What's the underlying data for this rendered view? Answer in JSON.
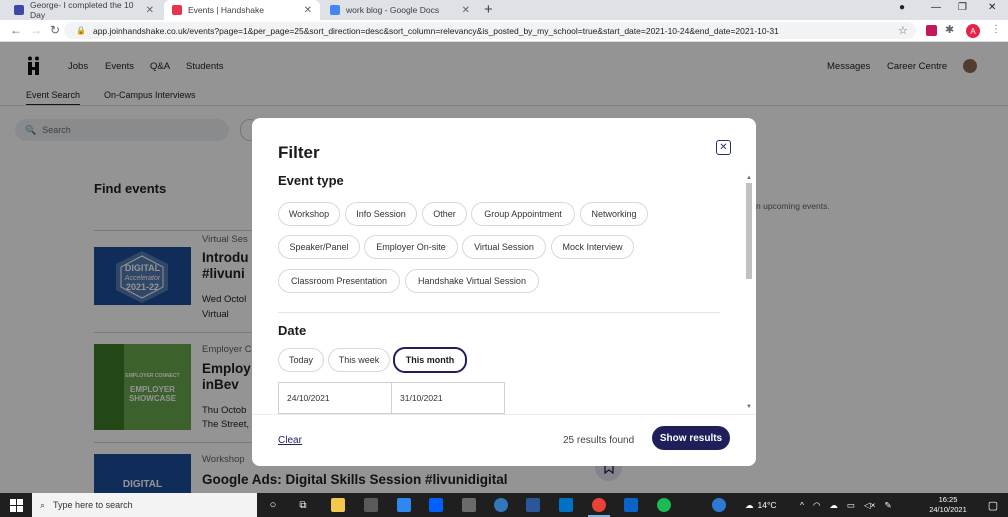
{
  "browser": {
    "tabs": [
      {
        "title": "George- I completed the 10 Day",
        "active": false
      },
      {
        "title": "Events | Handshake",
        "active": true
      },
      {
        "title": "work blog - Google Docs",
        "active": false
      }
    ],
    "url": "app.joinhandshake.co.uk/events?page=1&per_page=25&sort_direction=desc&sort_column=relevancy&is_posted_by_my_school=true&start_date=2021-10-24&end_date=2021-10-31",
    "profile_initial": "A"
  },
  "site": {
    "nav": [
      "Jobs",
      "Events",
      "Q&A",
      "Students"
    ],
    "nav_right": [
      "Messages",
      "Career Centre"
    ],
    "subnav": [
      "Event Search",
      "On-Campus Interviews"
    ],
    "search_placeholder": "Search",
    "find_title": "Find events",
    "upcoming_note": "n upcoming events."
  },
  "events": [
    {
      "type": "Virtual Ses",
      "title_line1": "Introdu",
      "title_line2": "#livuni",
      "meta1": "Wed Octol",
      "meta2": "Virtual",
      "thumb_lines": [
        "DIGITAL",
        "Accelerator",
        "2021-22"
      ]
    },
    {
      "type": "Employer C",
      "title_line1": "Employ",
      "title_line2": "inBev",
      "meta1": "Thu Octob",
      "meta2": "The Street, Guild of Students, Liverpool",
      "thumb_lines": [
        "EMPLOYER",
        "CONNECT",
        "EMPLOYER",
        "SHOWCASE"
      ]
    },
    {
      "type": "Workshop",
      "title_line1": "Google Ads: Digital Skills Session #livunidigital",
      "thumb_lines": [
        "DIGITAL"
      ]
    }
  ],
  "filter": {
    "title": "Filter",
    "event_type_heading": "Event type",
    "event_types": [
      "Workshop",
      "Info Session",
      "Other",
      "Group Appointment",
      "Networking",
      "Speaker/Panel",
      "Employer On-site",
      "Virtual Session",
      "Mock Interview",
      "Classroom Presentation",
      "Handshake Virtual Session"
    ],
    "date_heading": "Date",
    "date_options": [
      "Today",
      "This week",
      "This month"
    ],
    "selected_date_option": "This month",
    "start_date": "24/10/2021",
    "end_date": "31/10/2021",
    "clear_label": "Clear",
    "results_text": "25 results found",
    "show_results_label": "Show results"
  },
  "taskbar": {
    "search_placeholder": "Type here to search",
    "weather": "14°C",
    "time": "16:25",
    "date": "24/10/2021"
  },
  "colors": {
    "handshake_navy": "#1f1f5c",
    "overlay": "rgba(0,0,0,0.42)",
    "digital_blue": "#1d4f9a",
    "employer_green": "#6aa84f"
  }
}
